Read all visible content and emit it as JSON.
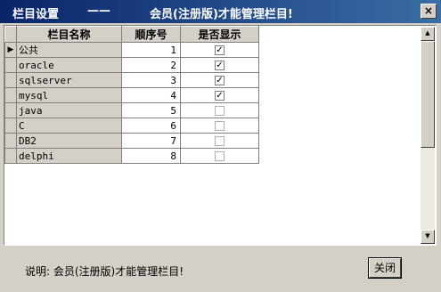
{
  "window": {
    "title_left": "栏目设置",
    "title_dash": "——",
    "title_main": "会员(注册版)才能管理栏目!",
    "close_glyph": "×"
  },
  "grid": {
    "headers": {
      "name": "栏目名称",
      "order": "顺序号",
      "show": "是否显示"
    },
    "rows": [
      {
        "name": "公共",
        "order": "1",
        "show": true
      },
      {
        "name": "oracle",
        "order": "2",
        "show": true
      },
      {
        "name": "sqlserver",
        "order": "3",
        "show": true
      },
      {
        "name": "mysql",
        "order": "4",
        "show": true
      },
      {
        "name": "java",
        "order": "5",
        "show": false
      },
      {
        "name": "C",
        "order": "6",
        "show": false
      },
      {
        "name": "DB2",
        "order": "7",
        "show": false
      },
      {
        "name": "delphi",
        "order": "8",
        "show": false
      }
    ]
  },
  "footer": {
    "note": "说明: 会员(注册版)才能管理栏目!",
    "close_label": "关闭"
  }
}
